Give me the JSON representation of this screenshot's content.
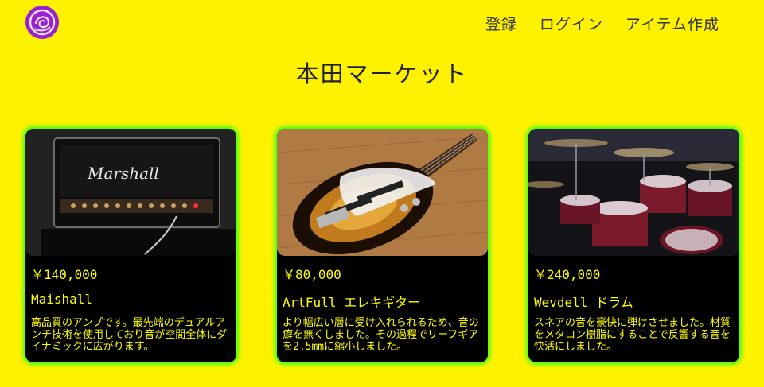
{
  "header": {
    "logo_icon": "rose-logo-icon",
    "nav": [
      {
        "label": "登録"
      },
      {
        "label": "ログイン"
      },
      {
        "label": "アイテム作成"
      }
    ]
  },
  "site_title": "本田マーケット",
  "colors": {
    "background": "#fff200",
    "card_background": "#000000",
    "card_glow": "#39ff14",
    "card_text": "#ffff00"
  },
  "items": [
    {
      "image_icon": "guitar-amp-image",
      "price": "￥140,000",
      "name": "Maishall",
      "description": "高品質のアンプです。最先端のデュアルアンチ技術を使用しており音が空間全体にダイナミックに広がります。"
    },
    {
      "image_icon": "electric-bass-image",
      "price": "￥80,000",
      "name": "ArtFull エレキギター",
      "description": "より幅広い層に受け入れられるため、音の癖を無くしました。その過程でリーフギアを2.5mmに縮小しました。"
    },
    {
      "image_icon": "drum-kit-image",
      "price": "￥240,000",
      "name": "Wevdell ドラム",
      "description": "スネアの音を豪快に弾けさせました。材質をメタロン樹脂にすることで反響する音を快活にしました。"
    }
  ]
}
